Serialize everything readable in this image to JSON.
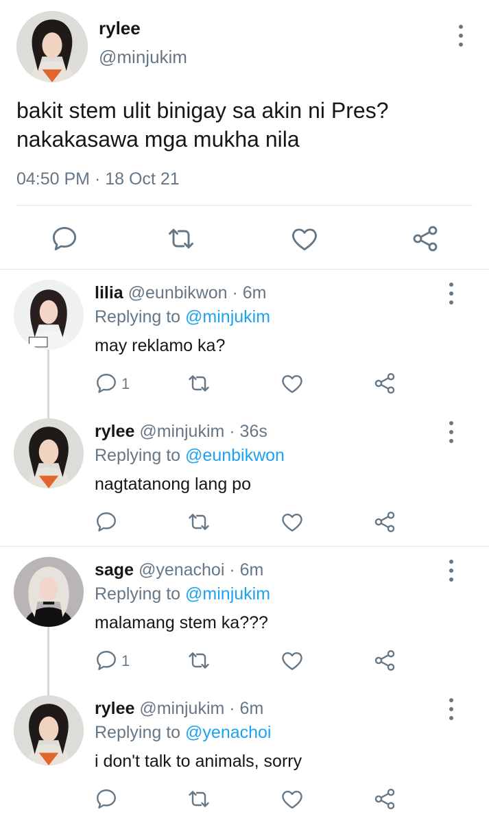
{
  "main_tweet": {
    "name": "rylee",
    "handle": "@minjukim",
    "text_line1": "bakit stem ulit binigay sa akin ni Pres?",
    "text_line2": "nakakasawa mga mukha nila",
    "timestamp": "04:50 PM · 18 Oct 21",
    "actions": [
      "reply-icon",
      "retweet-icon",
      "like-icon",
      "share-icon"
    ]
  },
  "replies": [
    {
      "name": "lilia",
      "handle": "@eunbikwon · 6m",
      "replying_prefix": "Replying to",
      "replying_to": "@minjukim",
      "text": "may reklamo ka?",
      "reply_count": "1"
    },
    {
      "name": "rylee",
      "handle": "@minjukim · 36s",
      "replying_prefix": "Replying to",
      "replying_to": "@eunbikwon",
      "text": "nagtatanong lang po",
      "reply_count": ""
    },
    {
      "name": "sage",
      "handle": "@yenachoi · 6m",
      "replying_prefix": "Replying to",
      "replying_to": "@minjukim",
      "text": "malamang stem ka???",
      "reply_count": "1"
    },
    {
      "name": "rylee",
      "handle": "@minjukim · 6m",
      "replying_prefix": "Replying to",
      "replying_to": "@yenachoi",
      "text": "i don't talk to animals, sorry",
      "reply_count": ""
    }
  ],
  "colors": {
    "text": "#14171a",
    "secondary": "#657786",
    "link": "#1da1f2",
    "divider": "#dfe3e6"
  }
}
